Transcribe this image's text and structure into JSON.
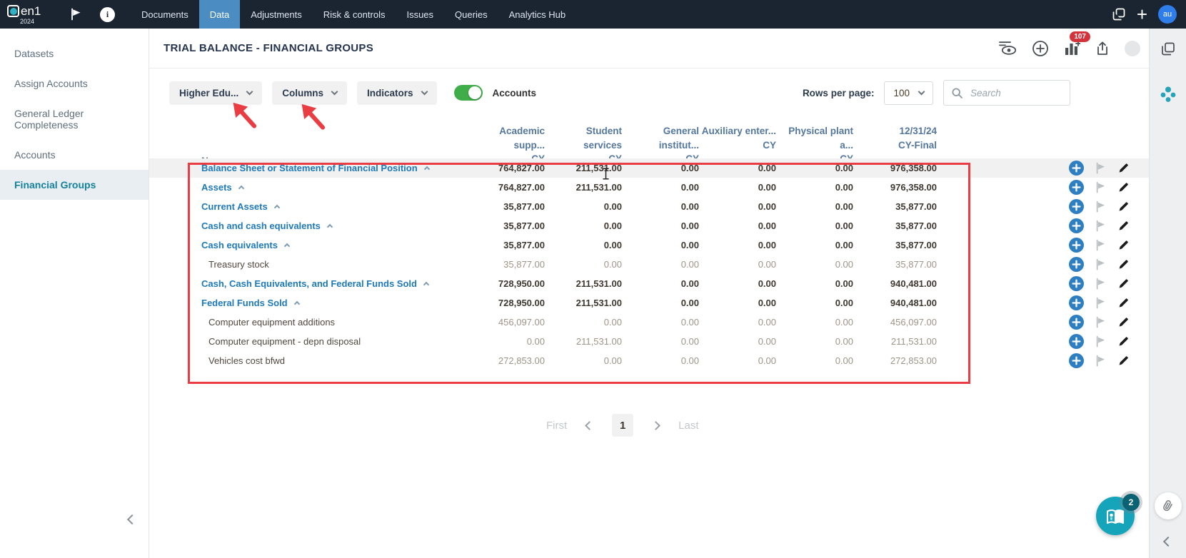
{
  "top_nav": {
    "logo_text": "en1",
    "logo_year": "2024",
    "items": [
      {
        "label": "Documents",
        "active": false
      },
      {
        "label": "Data",
        "active": true
      },
      {
        "label": "Adjustments",
        "active": false
      },
      {
        "label": "Risk & controls",
        "active": false
      },
      {
        "label": "Issues",
        "active": false
      },
      {
        "label": "Queries",
        "active": false
      },
      {
        "label": "Analytics Hub",
        "active": false
      }
    ],
    "avatar_initials": "au"
  },
  "sidebar": {
    "items": [
      {
        "label": "Datasets",
        "active": false
      },
      {
        "label": "Assign Accounts",
        "active": false
      },
      {
        "label": "General Ledger Completeness",
        "active": false
      },
      {
        "label": "Accounts",
        "active": false
      },
      {
        "label": "Financial Groups",
        "active": true
      }
    ]
  },
  "header": {
    "title": "TRIAL BALANCE - FINANCIAL GROUPS",
    "notifications_badge": "107"
  },
  "filters": {
    "primary_dropdown": "Higher Edu...",
    "columns_dropdown": "Columns",
    "indicators_dropdown": "Indicators",
    "accounts_toggle_label": "Accounts",
    "accounts_toggle_on": true,
    "rows_per_page_label": "Rows per page:",
    "rows_per_page_value": "100",
    "search_placeholder": "Search"
  },
  "table": {
    "name_header": "Name",
    "columns": [
      {
        "line1": "Academic supp...",
        "line2": "CY"
      },
      {
        "line1": "Student services",
        "line2": "CY"
      },
      {
        "line1": "General institut...",
        "line2": "CY"
      },
      {
        "line1": "Auxiliary enter...",
        "line2": "CY"
      },
      {
        "line1": "Physical plant a...",
        "line2": "CY"
      },
      {
        "line1": "12/31/24",
        "line2": "CY-Final"
      }
    ],
    "rows": [
      {
        "name": "Balance Sheet or Statement of Financial Position",
        "group": true,
        "shaded": true,
        "values": [
          "764,827.00",
          "211,531.00",
          "0.00",
          "0.00",
          "0.00",
          "976,358.00"
        ]
      },
      {
        "name": "Assets",
        "group": true,
        "shaded": false,
        "values": [
          "764,827.00",
          "211,531.00",
          "0.00",
          "0.00",
          "0.00",
          "976,358.00"
        ]
      },
      {
        "name": "Current Assets",
        "group": true,
        "shaded": false,
        "values": [
          "35,877.00",
          "0.00",
          "0.00",
          "0.00",
          "0.00",
          "35,877.00"
        ]
      },
      {
        "name": "Cash and cash equivalents",
        "group": true,
        "shaded": false,
        "values": [
          "35,877.00",
          "0.00",
          "0.00",
          "0.00",
          "0.00",
          "35,877.00"
        ]
      },
      {
        "name": "Cash equivalents",
        "group": true,
        "shaded": false,
        "values": [
          "35,877.00",
          "0.00",
          "0.00",
          "0.00",
          "0.00",
          "35,877.00"
        ]
      },
      {
        "name": "Treasury stock",
        "group": false,
        "shaded": false,
        "values": [
          "35,877.00",
          "0.00",
          "0.00",
          "0.00",
          "0.00",
          "35,877.00"
        ]
      },
      {
        "name": "Cash, Cash Equivalents, and Federal Funds Sold",
        "group": true,
        "shaded": false,
        "values": [
          "728,950.00",
          "211,531.00",
          "0.00",
          "0.00",
          "0.00",
          "940,481.00"
        ]
      },
      {
        "name": "Federal Funds Sold",
        "group": true,
        "shaded": false,
        "values": [
          "728,950.00",
          "211,531.00",
          "0.00",
          "0.00",
          "0.00",
          "940,481.00"
        ]
      },
      {
        "name": "Computer equipment additions",
        "group": false,
        "shaded": false,
        "values": [
          "456,097.00",
          "0.00",
          "0.00",
          "0.00",
          "0.00",
          "456,097.00"
        ]
      },
      {
        "name": "Computer equipment - depn disposal",
        "group": false,
        "shaded": false,
        "values": [
          "0.00",
          "211,531.00",
          "0.00",
          "0.00",
          "0.00",
          "211,531.00"
        ]
      },
      {
        "name": "Vehicles cost bfwd",
        "group": false,
        "shaded": false,
        "values": [
          "272,853.00",
          "0.00",
          "0.00",
          "0.00",
          "0.00",
          "272,853.00"
        ]
      }
    ]
  },
  "pagination": {
    "first_label": "First",
    "current_page": "1",
    "last_label": "Last"
  },
  "floating": {
    "help_badge": "2"
  },
  "icons": {
    "logo-mark": "white rounded square with teal circle",
    "flag-icon": "white pennant flag",
    "info-icon": "white circle with i",
    "copy-pages-icon": "two overlapping squares",
    "plus-icon": "plus sign",
    "visibility-settings-icon": "eye with slider lines",
    "add-circle-icon": "plus in circle outline",
    "chart-add-icon": "bar chart with plus",
    "export-icon": "box with up arrow",
    "search-icon": "magnifier",
    "row-add-icon": "blue filled circle plus",
    "row-flag-icon": "gray pennant",
    "edit-pencil-icon": "black pencil",
    "cluster-icon": "teal four-dot cluster",
    "paperclip-icon": "paperclip",
    "help-book-icon": "open book with lightbulb",
    "annotation": "red box and red arrows",
    "text-cursor": "i-beam mouse cursor"
  },
  "colors": {
    "topbar_bg": "#1b2532",
    "active_nav": "#4b8cc2",
    "avatar_blue": "#2e7de9",
    "link_blue": "#1e79b8",
    "annotation_red": "#ea3d43",
    "toggle_green": "#3fae49",
    "teal_button": "#16a4ba",
    "active_sidebar_text": "#15819d",
    "badge_red": "#d5333c"
  }
}
